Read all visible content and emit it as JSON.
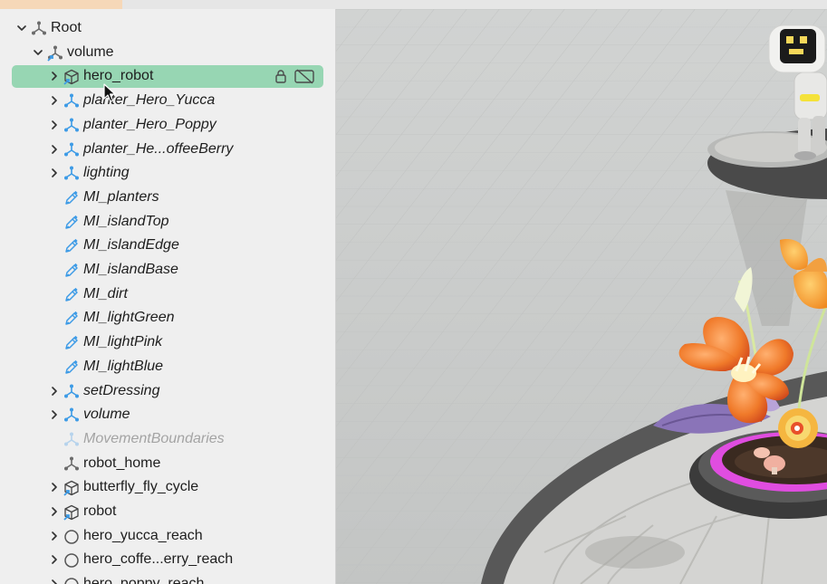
{
  "outline": {
    "items": [
      {
        "label": "Root",
        "depth": 0,
        "expandable": true,
        "expanded": true,
        "icon": "xform",
        "style": "normal"
      },
      {
        "label": "volume",
        "depth": 1,
        "expandable": true,
        "expanded": true,
        "icon": "xform-link",
        "style": "normal"
      },
      {
        "label": "hero_robot",
        "depth": 2,
        "expandable": true,
        "expanded": false,
        "icon": "cube-link",
        "style": "normal",
        "selected": true
      },
      {
        "label": "planter_Hero_Yucca",
        "depth": 2,
        "expandable": true,
        "icon": "xform-blue",
        "style": "italic"
      },
      {
        "label": "planter_Hero_Poppy",
        "depth": 2,
        "expandable": true,
        "icon": "xform-blue",
        "style": "italic"
      },
      {
        "label": "planter_He...offeeBerry",
        "depth": 2,
        "expandable": true,
        "icon": "xform-blue",
        "style": "italic"
      },
      {
        "label": "lighting",
        "depth": 2,
        "expandable": true,
        "icon": "xform-blue",
        "style": "italic"
      },
      {
        "label": "MI_planters",
        "depth": 2,
        "expandable": false,
        "icon": "material",
        "style": "italic"
      },
      {
        "label": "MI_islandTop",
        "depth": 2,
        "expandable": false,
        "icon": "material",
        "style": "italic"
      },
      {
        "label": "MI_islandEdge",
        "depth": 2,
        "expandable": false,
        "icon": "material",
        "style": "italic"
      },
      {
        "label": "MI_islandBase",
        "depth": 2,
        "expandable": false,
        "icon": "material",
        "style": "italic"
      },
      {
        "label": "MI_dirt",
        "depth": 2,
        "expandable": false,
        "icon": "material",
        "style": "italic"
      },
      {
        "label": "MI_lightGreen",
        "depth": 2,
        "expandable": false,
        "icon": "material",
        "style": "italic"
      },
      {
        "label": "MI_lightPink",
        "depth": 2,
        "expandable": false,
        "icon": "material",
        "style": "italic"
      },
      {
        "label": "MI_lightBlue",
        "depth": 2,
        "expandable": false,
        "icon": "material",
        "style": "italic"
      },
      {
        "label": "setDressing",
        "depth": 2,
        "expandable": true,
        "icon": "xform-blue",
        "style": "italic"
      },
      {
        "label": "volume",
        "depth": 2,
        "expandable": true,
        "icon": "xform-blue",
        "style": "italic"
      },
      {
        "label": "MovementBoundaries",
        "depth": 2,
        "expandable": false,
        "icon": "xform-faded",
        "style": "dim"
      },
      {
        "label": "robot_home",
        "depth": 2,
        "expandable": false,
        "icon": "xform",
        "style": "normal"
      },
      {
        "label": "butterfly_fly_cycle",
        "depth": 2,
        "expandable": true,
        "icon": "cube-link",
        "style": "normal"
      },
      {
        "label": "robot",
        "depth": 2,
        "expandable": true,
        "icon": "cube-link",
        "style": "normal"
      },
      {
        "label": "hero_yucca_reach",
        "depth": 2,
        "expandable": true,
        "icon": "circle",
        "style": "normal"
      },
      {
        "label": "hero_coffe...erry_reach",
        "depth": 2,
        "expandable": true,
        "icon": "circle",
        "style": "normal"
      },
      {
        "label": "hero_poppy_reach",
        "depth": 2,
        "expandable": true,
        "icon": "circle",
        "style": "normal"
      }
    ],
    "row_icons": [
      "lock-icon",
      "visibility-off-icon"
    ]
  },
  "colors": {
    "selection": "#97d6b3",
    "accent_blue": "#3d9be6",
    "panel_bg": "#efefef",
    "viewport_bg": "#c9cbca",
    "flower_orange": "#f07a2a",
    "planter_glow": "#e04de0"
  }
}
